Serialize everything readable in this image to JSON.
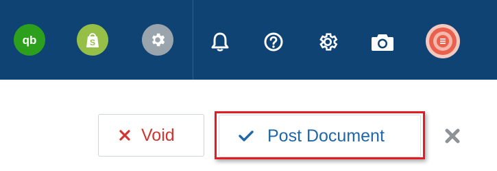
{
  "header": {
    "apps": [
      {
        "name": "QuickBooks",
        "icon": "quickbooks-icon",
        "text": "qb",
        "color": "#2ca01c"
      },
      {
        "name": "Shopify",
        "icon": "shopify-icon",
        "text": "S",
        "color": "#95bf47"
      },
      {
        "name": "Settings app",
        "icon": "gear-icon",
        "color": "#9aa4ad"
      }
    ],
    "nav_icons": [
      "bell-icon",
      "help-icon",
      "gear-icon",
      "camera-icon"
    ],
    "background": "#0e4374"
  },
  "actions": {
    "void_label": "Void",
    "void_color": "#d13532",
    "post_label": "Post Document",
    "post_color": "#1f67a6",
    "highlight_color": "#e31b23",
    "close_icon": "close-icon"
  }
}
